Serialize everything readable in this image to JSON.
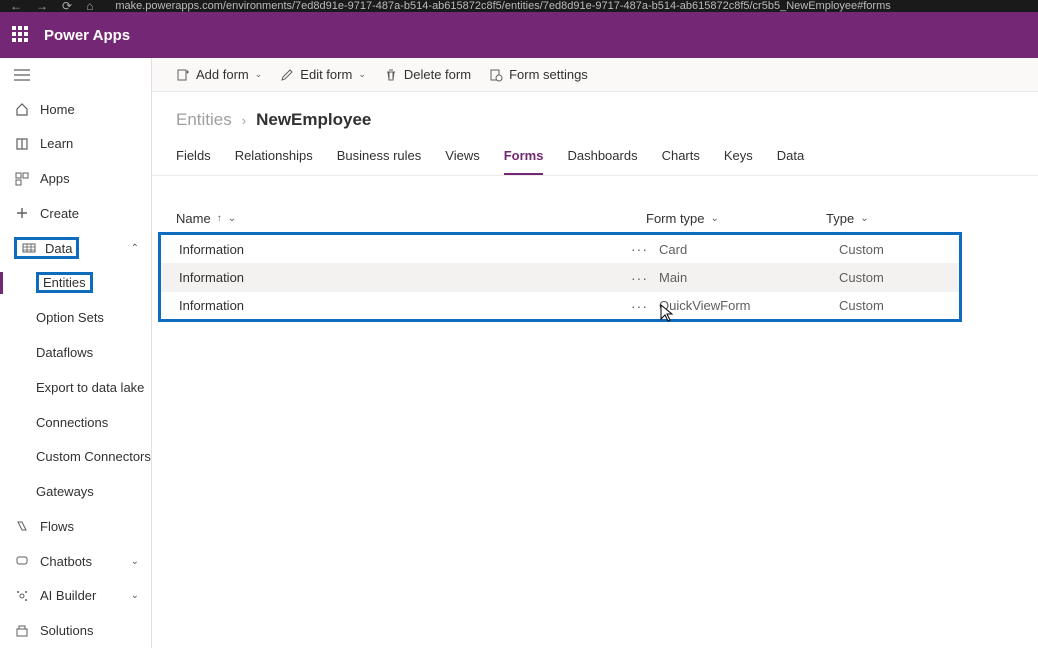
{
  "browser": {
    "url": "make.powerapps.com/environments/7ed8d91e-9717-487a-b514-ab615872c8f5/entities/7ed8d91e-9717-487a-b514-ab615872c8f5/cr5b5_NewEmployee#forms"
  },
  "header": {
    "appName": "Power Apps"
  },
  "sidebar": {
    "items": [
      {
        "label": "Home"
      },
      {
        "label": "Learn"
      },
      {
        "label": "Apps"
      },
      {
        "label": "Create"
      },
      {
        "label": "Data"
      },
      {
        "label": "Flows"
      },
      {
        "label": "Chatbots"
      },
      {
        "label": "AI Builder"
      },
      {
        "label": "Solutions"
      }
    ],
    "dataChildren": [
      {
        "label": "Entities"
      },
      {
        "label": "Option Sets"
      },
      {
        "label": "Dataflows"
      },
      {
        "label": "Export to data lake"
      },
      {
        "label": "Connections"
      },
      {
        "label": "Custom Connectors"
      },
      {
        "label": "Gateways"
      }
    ]
  },
  "commandBar": {
    "addForm": "Add form",
    "editForm": "Edit form",
    "deleteForm": "Delete form",
    "formSettings": "Form settings"
  },
  "breadcrumb": {
    "root": "Entities",
    "current": "NewEmployee"
  },
  "tabs": [
    {
      "label": "Fields"
    },
    {
      "label": "Relationships"
    },
    {
      "label": "Business rules"
    },
    {
      "label": "Views"
    },
    {
      "label": "Forms",
      "active": true
    },
    {
      "label": "Dashboards"
    },
    {
      "label": "Charts"
    },
    {
      "label": "Keys"
    },
    {
      "label": "Data"
    }
  ],
  "table": {
    "columns": {
      "name": "Name",
      "formType": "Form type",
      "type": "Type"
    },
    "rows": [
      {
        "name": "Information",
        "formType": "Card",
        "type": "Custom"
      },
      {
        "name": "Information",
        "formType": "Main",
        "type": "Custom",
        "hover": true
      },
      {
        "name": "Information",
        "formType": "QuickViewForm",
        "type": "Custom"
      }
    ]
  }
}
